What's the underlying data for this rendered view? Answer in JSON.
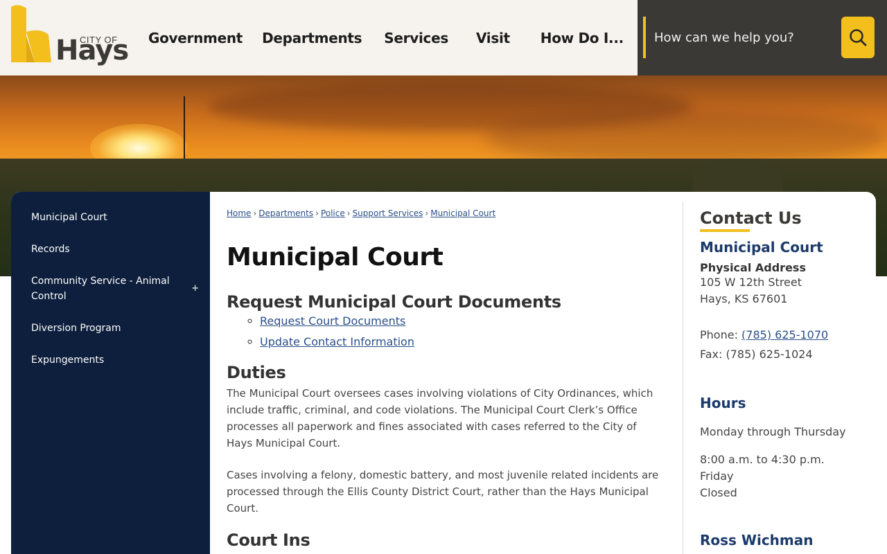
{
  "logo": {
    "city": "CITY OF",
    "name": "Hays"
  },
  "nav": {
    "items": [
      {
        "label": "Government"
      },
      {
        "label": "Departments"
      },
      {
        "label": "Services"
      },
      {
        "label": "Visit"
      },
      {
        "label": "How Do I..."
      }
    ]
  },
  "search": {
    "placeholder": "How can we help you?",
    "icon": "search-icon"
  },
  "colors": {
    "accent": "#f2bf1d",
    "sidebar": "#0d1f3d",
    "header_dark": "#3b3935",
    "link": "#2a4f8a",
    "heading_blue": "#1b3a6a"
  },
  "sidebar": {
    "items": [
      {
        "label": "Municipal Court"
      },
      {
        "label": "Records"
      },
      {
        "label": "Community Service - Animal Control",
        "expand": "+"
      },
      {
        "label": "Diversion Program"
      },
      {
        "label": "Expungements"
      }
    ]
  },
  "breadcrumb": {
    "items": [
      "Home",
      "Departments",
      "Police",
      "Support Services",
      "Municipal Court"
    ],
    "separator": "›"
  },
  "main": {
    "title": "Municipal Court",
    "request_heading": "Request Municipal Court Documents",
    "links": [
      "Request Court Documents",
      "Update Contact Information"
    ],
    "duties_heading": "Duties",
    "duties_p1": "The Municipal Court oversees cases involving violations of City Ordinances, which include traffic, criminal, and code violations. The Municipal Court Clerk’s Office processes all paperwork and fines associated with cases referred to the City of Hays Municipal Court.",
    "duties_p2": "Cases involving a felony, domestic battery, and most juvenile related incidents are processed through the Ellis County District Court, rather than the Hays Municipal Court.",
    "next_heading_partial": "Court Ins"
  },
  "contact": {
    "title": "Contact Us",
    "org": "Municipal Court",
    "address_label": "Physical Address",
    "address_line1": "105 W 12th Street",
    "address_line2": "Hays, KS 67601",
    "phone_label": "Phone:",
    "phone": "(785) 625-1070",
    "fax": "Fax: (785) 625-1024",
    "hours_title": "Hours",
    "hours_days": "Monday through Thursday",
    "hours_time": "8:00 a.m. to 4:30 p.m.",
    "hours_day2": "Friday",
    "hours_closed": "Closed",
    "person": "Ross Wichman"
  }
}
